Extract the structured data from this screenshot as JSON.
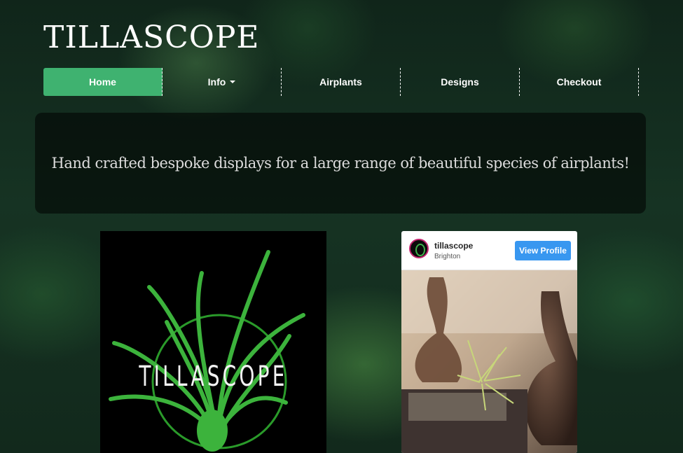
{
  "site": {
    "title": "TILLASCOPE"
  },
  "nav": {
    "items": [
      {
        "label": "Home"
      },
      {
        "label": "Info"
      },
      {
        "label": "Airplants"
      },
      {
        "label": "Designs"
      },
      {
        "label": "Checkout"
      }
    ],
    "accent_color": "#3fb270"
  },
  "hero": {
    "text": "Hand crafted bespoke displays for a large range of beautiful species of airplants!"
  },
  "logo": {
    "wordmark": "TILLASCOPE"
  },
  "instagram": {
    "handle": "tillascope",
    "location": "Brighton",
    "button_label": "View Profile",
    "button_color": "#3897f0",
    "avatar_icon": "tillascope-avatar-icon"
  }
}
